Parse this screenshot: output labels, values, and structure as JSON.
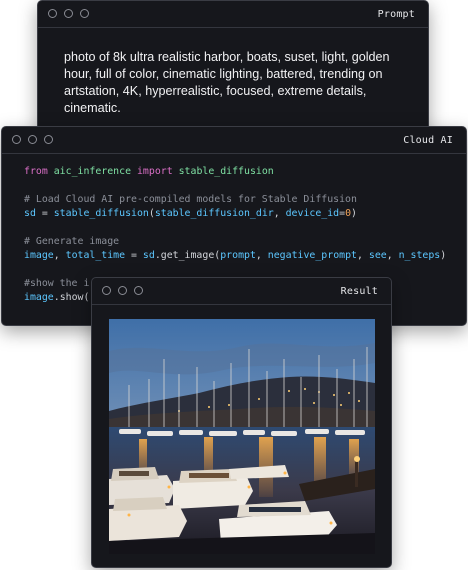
{
  "prompt_window": {
    "title": "Prompt",
    "text": "photo of 8k ultra realistic harbor, boats, suset, light, golden hour, full of color, cinematic lighting, battered, trending on artstation, 4K, hyperrealistic, focused, extreme details, cinematic."
  },
  "code_window": {
    "title": "Cloud AI",
    "line1": {
      "kw_from": "from",
      "module": "aic_inference",
      "kw_import": "import",
      "name": "stable_diffusion"
    },
    "line2": {
      "comment": "# Load Cloud AI pre-compiled models for Stable Diffusion"
    },
    "line3": {
      "var": "sd",
      "eq": " = ",
      "fn": "stable_diffusion",
      "open": "(",
      "arg1": "stable_diffusion_dir",
      "sep": ", ",
      "kwarg": "device_id",
      "assign": "=",
      "num": "0",
      "close": ")"
    },
    "line4": {
      "comment": "# Generate image"
    },
    "line5": {
      "v1": "image",
      "c1": ", ",
      "v2": "total_time",
      "eq": " = ",
      "obj": "sd",
      "dot": ".",
      "method": "get_image",
      "open": "(",
      "a1": "prompt",
      "s1": ", ",
      "a2": "negative_prompt",
      "s2": ", ",
      "a3": "see",
      "s3": ", ",
      "a4": "n_steps",
      "close": ")"
    },
    "line6": {
      "comment": "#show the i"
    },
    "line7": {
      "obj": "image",
      "dot": ".",
      "method": "show",
      "open": "("
    }
  },
  "result_window": {
    "title": "Result",
    "image": "harbor-sunset-boats-photo"
  },
  "colors": {
    "window_bg": "#16171c",
    "keyword": "#d96fc6",
    "identifier": "#5cc7ff",
    "function": "#7fe0a3",
    "comment": "#8b8f99",
    "number": "#f0a35a"
  }
}
